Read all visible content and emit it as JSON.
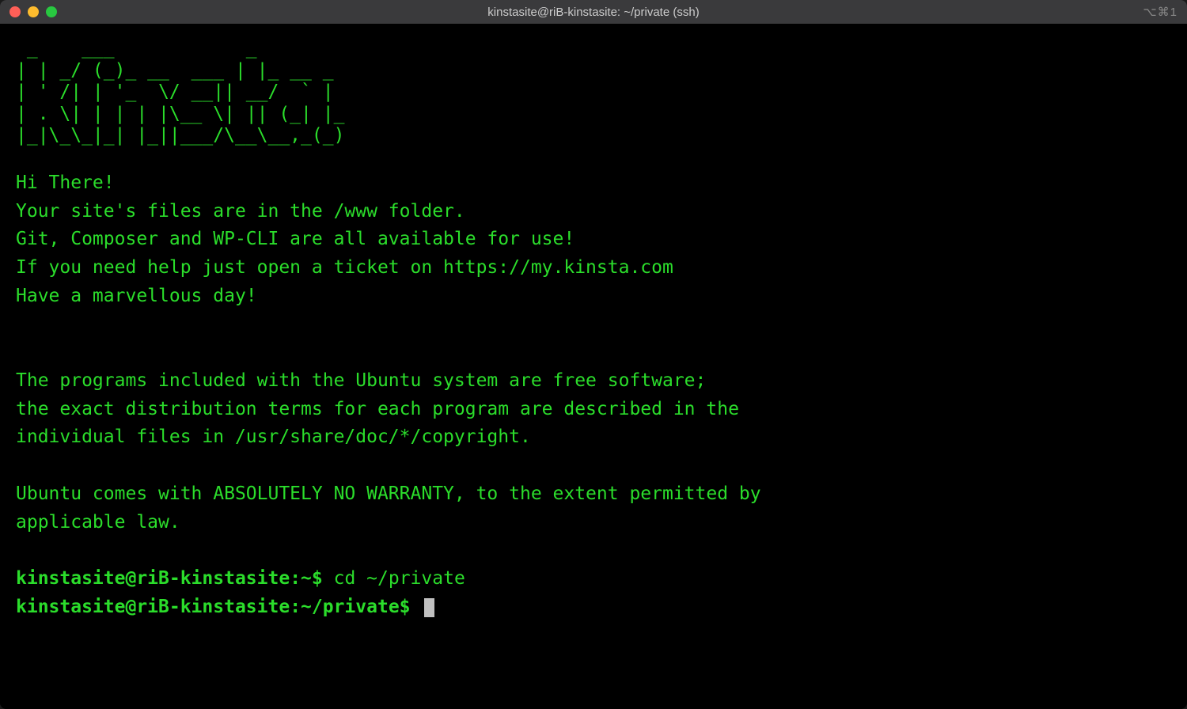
{
  "titlebar": {
    "title": "kinstasite@riB-kinstasite: ~/private (ssh)",
    "shortcut_hint": "⌥⌘1"
  },
  "ascii_art": " _    ___            _\n| | _/ (_)_ __  ___ | |_ __ _\n| ' /| | '_  \\/ __|| __/  ` |\n| . \\| | | | |\\__ \\| || (_| |_\n|_|\\_\\_|_| |_||___/\\__\\__,_(_)",
  "motd": [
    "Hi There!",
    "Your site's files are in the /www folder.",
    "Git, Composer and WP-CLI are all available for use!",
    "If you need help just open a ticket on https://my.kinsta.com",
    "Have a marvellous day!"
  ],
  "legal": [
    "The programs included with the Ubuntu system are free software;",
    "the exact distribution terms for each program are described in the",
    "individual files in /usr/share/doc/*/copyright."
  ],
  "warranty": [
    "Ubuntu comes with ABSOLUTELY NO WARRANTY, to the extent permitted by",
    "applicable law."
  ],
  "prompts": [
    {
      "user_host": "kinstasite@riB-kinstasite",
      "separator": ":",
      "path": "~",
      "sigil": "$",
      "command": "cd ~/private"
    },
    {
      "user_host": "kinstasite@riB-kinstasite",
      "separator": ":",
      "path": "~/private",
      "sigil": "$",
      "command": ""
    }
  ]
}
